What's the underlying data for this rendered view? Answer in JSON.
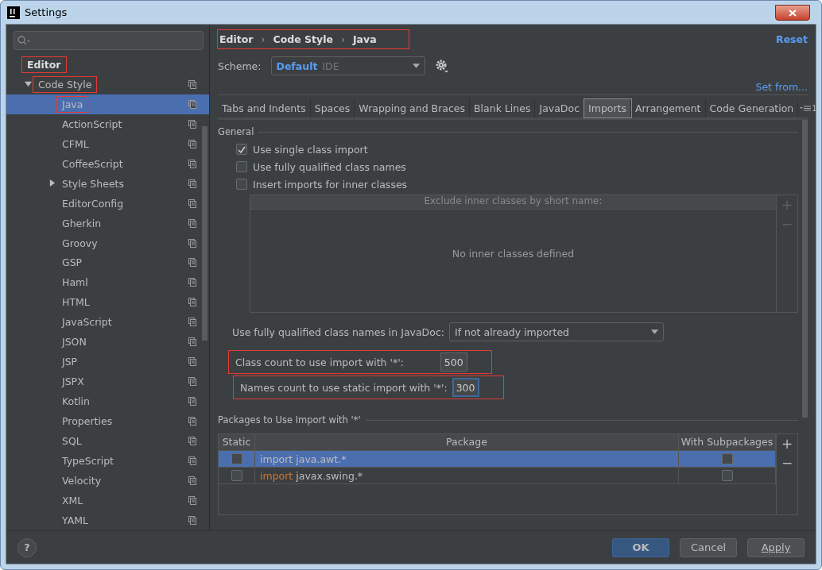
{
  "window": {
    "title": "Settings"
  },
  "sidebar": {
    "tree": [
      {
        "label": "Editor",
        "highlighted": true,
        "selected": false,
        "children": [
          {
            "label": "Code Style",
            "expanded": true,
            "highlighted": true,
            "selected": false,
            "children": [
              {
                "label": "Java",
                "selected": true,
                "highlighted": true
              },
              {
                "label": "ActionScript",
                "selected": false
              },
              {
                "label": "CFML",
                "selected": false
              },
              {
                "label": "CoffeeScript",
                "selected": false
              },
              {
                "label": "Style Sheets",
                "selected": false,
                "expanded": false
              },
              {
                "label": "EditorConfig",
                "selected": false
              },
              {
                "label": "Gherkin",
                "selected": false
              },
              {
                "label": "Groovy",
                "selected": false
              },
              {
                "label": "GSP",
                "selected": false
              },
              {
                "label": "Haml",
                "selected": false
              },
              {
                "label": "HTML",
                "selected": false
              },
              {
                "label": "JavaScript",
                "selected": false
              },
              {
                "label": "JSON",
                "selected": false
              },
              {
                "label": "JSP",
                "selected": false
              },
              {
                "label": "JSPX",
                "selected": false
              },
              {
                "label": "Kotlin",
                "selected": false
              },
              {
                "label": "Properties",
                "selected": false
              },
              {
                "label": "SQL",
                "selected": false
              },
              {
                "label": "TypeScript",
                "selected": false
              },
              {
                "label": "Velocity",
                "selected": false
              },
              {
                "label": "XML",
                "selected": false
              },
              {
                "label": "YAML",
                "selected": false
              }
            ]
          }
        ]
      }
    ]
  },
  "breadcrumb": {
    "items": [
      "Editor",
      "Code Style",
      "Java"
    ],
    "separator": "›",
    "highlighted": true
  },
  "reset": "Reset",
  "scheme": {
    "label": "Scheme:",
    "name": "Default",
    "sub": "IDE"
  },
  "set_from": "Set from...",
  "tabs": [
    {
      "label": "Tabs and Indents",
      "selected": false
    },
    {
      "label": "Spaces",
      "selected": false
    },
    {
      "label": "Wrapping and Braces",
      "selected": false
    },
    {
      "label": "Blank Lines",
      "selected": false
    },
    {
      "label": "JavaDoc",
      "selected": false
    },
    {
      "label": "Imports",
      "selected": true,
      "highlighted": true
    },
    {
      "label": "Arrangement",
      "selected": false
    },
    {
      "label": "Code Generation",
      "selected": false
    }
  ],
  "tabs_overflow": "1",
  "general": {
    "title": "General",
    "options": [
      {
        "label": "Use single class import",
        "checked": true
      },
      {
        "label": "Use fully qualified class names",
        "checked": false
      },
      {
        "label": "Insert imports for inner classes",
        "checked": false
      }
    ],
    "exclude_table": {
      "header": "Exclude inner classes by short name:",
      "empty_text": "No inner classes defined",
      "add": "+",
      "remove": "−"
    }
  },
  "javadoc": {
    "label": "Use fully qualified class names in JavaDoc:",
    "value": "If not already imported"
  },
  "counts": [
    {
      "label": "Class count to use import with '*':",
      "value": "500",
      "focused": false,
      "highlighted": true
    },
    {
      "label": "Names count to use static import with '*':",
      "value": "300",
      "focused": true,
      "highlighted": true
    }
  ],
  "packages": {
    "title": "Packages to Use Import with '*'",
    "columns": [
      "Static",
      "Package",
      "With Subpackages"
    ],
    "rows": [
      {
        "static": false,
        "keyword": "import",
        "name": "java.awt.*",
        "subpackages": false,
        "selected": true
      },
      {
        "static": false,
        "keyword": "import",
        "name": "javax.swing.*",
        "subpackages": false,
        "selected": false
      }
    ],
    "add": "+",
    "remove": "−"
  },
  "buttons": [
    {
      "label": "OK",
      "kind": "primary"
    },
    {
      "label": "Cancel",
      "kind": "normal"
    },
    {
      "label": "Apply",
      "kind": "underline"
    }
  ],
  "help": "?"
}
